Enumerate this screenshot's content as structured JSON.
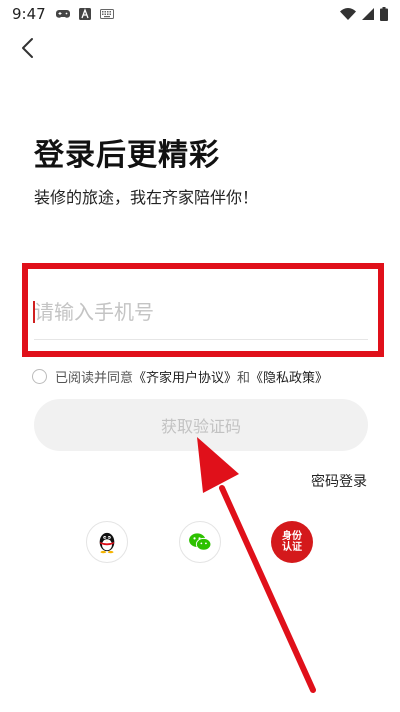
{
  "status_bar": {
    "time": "9:47",
    "left_icons": [
      "gamepad-icon",
      "app-a-icon",
      "keyboard-icon"
    ],
    "right_icons": [
      "wifi-icon",
      "signal-icon",
      "battery-icon"
    ]
  },
  "header": {
    "back_icon": "chevron-left-icon"
  },
  "main": {
    "title": "登录后更精彩",
    "subtitle": "装修的旅途，我在齐家陪伴你！",
    "phone_input": {
      "value": "",
      "placeholder": "请输入手机号"
    },
    "agreement": {
      "prefix": "已阅读并同意",
      "user_agreement": "《齐家用户协议》",
      "connector": "和",
      "privacy_policy": "《隐私政策》"
    },
    "get_code_label": "获取验证码",
    "password_login_label": "密码登录",
    "social_logins": {
      "qq_icon": "qq-penguin-icon",
      "wechat_icon": "wechat-icon",
      "id_label_line1": "身份",
      "id_label_line2": "认证"
    }
  },
  "colors": {
    "annotation_red": "#e0101a",
    "button_disabled_bg": "#f1f1f1",
    "button_disabled_text": "#c2c2c2",
    "wechat_green": "#2dc100"
  }
}
